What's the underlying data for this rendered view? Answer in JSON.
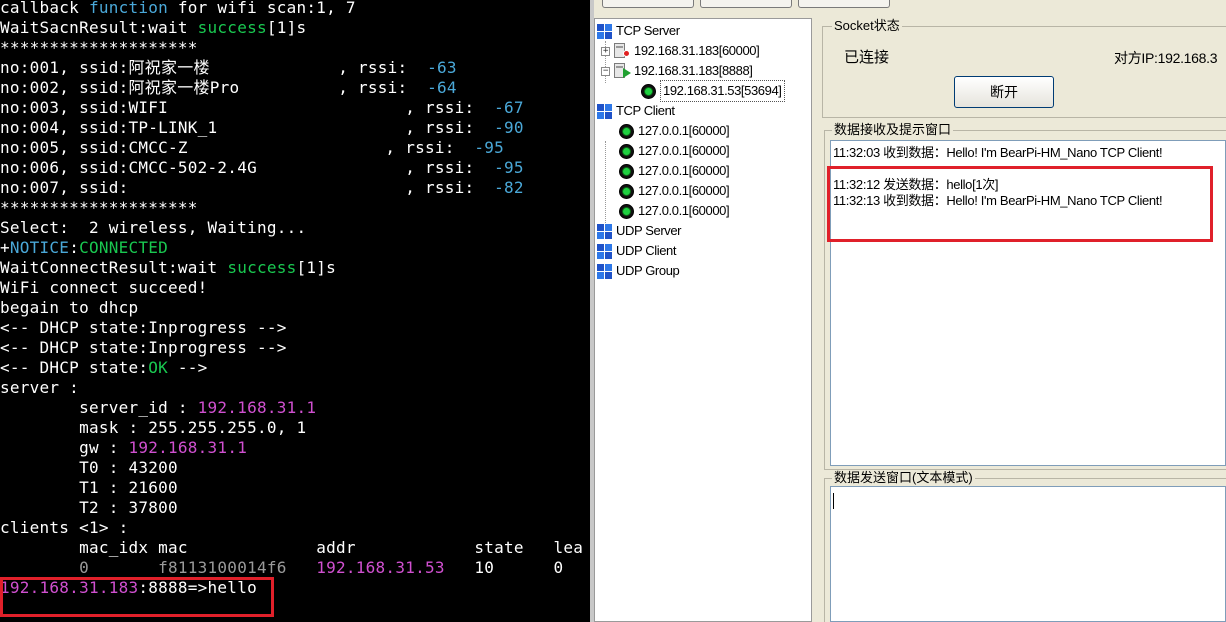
{
  "terminal": {
    "lines": [
      [
        {
          "t": "callback "
        },
        {
          "t": "function",
          "c": "blue"
        },
        {
          "t": " for wifi scan:1, 7"
        }
      ],
      [
        {
          "t": "WaitSacnResult:wait "
        },
        {
          "t": "success",
          "c": "green"
        },
        {
          "t": "[1]s"
        }
      ],
      [
        {
          "t": "********************"
        }
      ],
      [
        {
          "t": "no:001, ssid:阿祝家一楼             , rssi:  "
        },
        {
          "t": "-63",
          "c": "blue"
        }
      ],
      [
        {
          "t": "no:002, ssid:阿祝家一楼Pro          , rssi:  "
        },
        {
          "t": "-64",
          "c": "blue"
        }
      ],
      [
        {
          "t": "no:003, ssid:WIFI                        , rssi:  "
        },
        {
          "t": "-67",
          "c": "blue"
        }
      ],
      [
        {
          "t": "no:004, ssid:TP-LINK_1                   , rssi:  "
        },
        {
          "t": "-90",
          "c": "blue"
        }
      ],
      [
        {
          "t": "no:005, ssid:CMCC-Z                    , rssi:  "
        },
        {
          "t": "-95",
          "c": "blue"
        }
      ],
      [
        {
          "t": "no:006, ssid:CMCC-502-2.4G               , rssi:  "
        },
        {
          "t": "-95",
          "c": "blue"
        }
      ],
      [
        {
          "t": "no:007, ssid:                            , rssi:  "
        },
        {
          "t": "-82",
          "c": "blue"
        }
      ],
      [
        {
          "t": "********************"
        }
      ],
      [
        {
          "t": "Select:  2 wireless, Waiting..."
        }
      ],
      [
        {
          "t": "+"
        },
        {
          "t": "NOTICE",
          "c": "blue"
        },
        {
          "t": ":"
        },
        {
          "t": "CONNECTED",
          "c": "green"
        }
      ],
      [
        {
          "t": "WaitConnectResult:wait "
        },
        {
          "t": "success",
          "c": "green"
        },
        {
          "t": "[1]s"
        }
      ],
      [
        {
          "t": "WiFi connect succeed!"
        }
      ],
      [
        {
          "t": "begain to dhcp"
        }
      ],
      [
        {
          "t": "<-- DHCP state:Inprogress -->"
        }
      ],
      [
        {
          "t": "<-- DHCP state:Inprogress -->"
        }
      ],
      [
        {
          "t": "<-- DHCP state:"
        },
        {
          "t": "OK",
          "c": "green"
        },
        {
          "t": " -->"
        }
      ],
      [
        {
          "t": "server :"
        }
      ],
      [
        {
          "t": "        server_id : "
        },
        {
          "t": "192.168.31.1",
          "c": "mag"
        }
      ],
      [
        {
          "t": "        mask : 255.255.255.0, 1"
        }
      ],
      [
        {
          "t": "        gw : "
        },
        {
          "t": "192.168.31.1",
          "c": "mag"
        }
      ],
      [
        {
          "t": "        T0 : 43200"
        }
      ],
      [
        {
          "t": "        T1 : 21600"
        }
      ],
      [
        {
          "t": "        T2 : 37800"
        }
      ],
      [
        {
          "t": "clients <1> :"
        }
      ],
      [
        {
          "t": "        mac_idx mac             addr            state   lea"
        }
      ],
      [
        {
          "t": "        0       f8113100014f6   ",
          "c": "gray"
        },
        {
          "t": "192.168.31.53",
          "c": "mag"
        },
        {
          "t": "   10      0"
        }
      ],
      [
        {
          "t": "192.168.31.183",
          "c": "mag"
        },
        {
          "t": ":8888=>hello"
        }
      ]
    ]
  },
  "tree": {
    "categories": {
      "tcp_server": "TCP Server",
      "tcp_client": "TCP Client",
      "udp_server": "UDP Server",
      "udp_client": "UDP Client",
      "udp_group": "UDP Group"
    },
    "servers": [
      {
        "label": "192.168.31.183[60000]",
        "expander": "+",
        "status": "stopped"
      },
      {
        "label": "192.168.31.183[8888]",
        "expander": "−",
        "status": "running"
      }
    ],
    "server_connection": "192.168.31.53[53694]",
    "clients": [
      "127.0.0.1[60000]",
      "127.0.0.1[60000]",
      "127.0.0.1[60000]",
      "127.0.0.1[60000]",
      "127.0.0.1[60000]"
    ]
  },
  "socket": {
    "group_title": "Socket状态",
    "status": "已连接",
    "peer_ip": "对方IP:192.168.3",
    "disconnect_label": "断开"
  },
  "receive": {
    "group_title": "数据接收及提示窗口",
    "lines": [
      "11:32:03 收到数据：Hello! I'm BearPi-HM_Nano TCP Client!",
      "",
      "11:32:12 发送数据：hello[1次]",
      "11:32:13 收到数据：Hello! I'm BearPi-HM_Nano TCP Client!"
    ]
  },
  "send": {
    "group_title": "数据发送窗口(文本模式)",
    "value": ""
  },
  "colors": {
    "terminal_bg": "#000000",
    "highlight_red": "#e0202a",
    "app_bg": "#ece9d8"
  }
}
